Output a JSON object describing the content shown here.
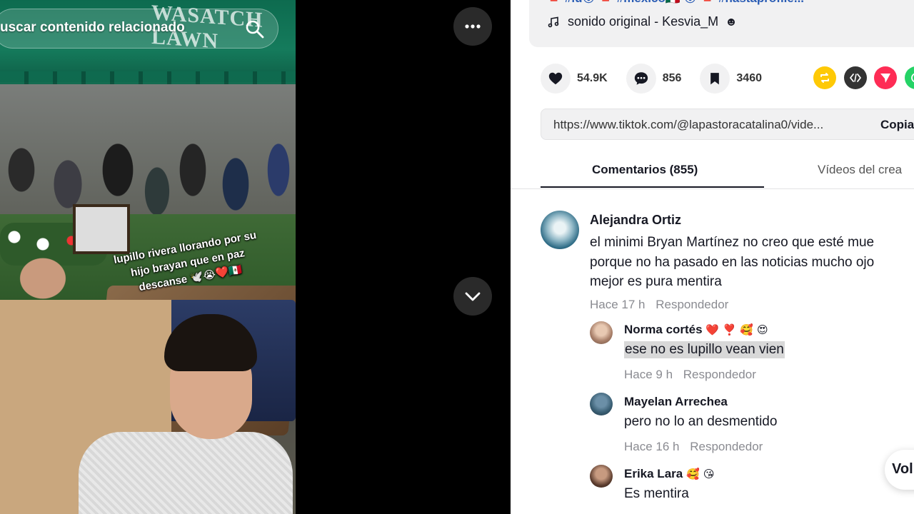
{
  "video": {
    "search_text": "uscar contenido relacionado",
    "tent_text": "WASATCH LAWN",
    "caption_line1": "lupillo rivera llorando por su",
    "caption_line2": "hijo brayan que en paz",
    "caption_line3": "descanse 🕊️😭❤️🇲🇽",
    "icons": [
      "search-icon",
      "more-icon",
      "chevron-down-icon"
    ]
  },
  "description": {
    "tags": "🔺 #lu😮 🔺 #mexico🇲🇽 😮 🔺 #hastaprofile...",
    "sound_label": "sonido original - Kesvia_M"
  },
  "actions": {
    "likes": "54.9K",
    "comments": "856",
    "saves": "3460"
  },
  "share_colors": {
    "repost": "#fec906",
    "embed": "#333333",
    "send": "#fe2c55",
    "whatsapp": "#25d366"
  },
  "link": {
    "url": "https://www.tiktok.com/@lapastoracatalina0/vide...",
    "copy_label": "Copia"
  },
  "tabs": {
    "comments_label": "Comentarios (855)",
    "videos_label": "Vídeos del crea"
  },
  "comments": [
    {
      "author": "Alejandra Ortiz",
      "text_line1": "el minimi Bryan Martínez no creo que esté mue",
      "text_line2": "porque no ha pasado en las noticias mucho ojo",
      "text_line3": "mejor es pura mentira",
      "time": "Hace 17 h",
      "reply_label": "Respondedor"
    }
  ],
  "replies": [
    {
      "author": "Norma cortés",
      "emojis": "❤️ ❣️ 🥰 😍",
      "text": "ese no es lupillo vean vien",
      "time": "Hace 9 h",
      "reply_label": "Respondedor"
    },
    {
      "author": "Mayelan Arrechea",
      "text": "pero no lo an desmentido",
      "time": "Hace 16 h",
      "reply_label": "Respondedor"
    },
    {
      "author": "Erika Lara",
      "emojis": "🥰 😘",
      "text": "Es mentira",
      "time": "",
      "reply_label": ""
    }
  ],
  "floating": {
    "vol_label": "Vol"
  },
  "colors": {
    "accent": "#fe2c55",
    "link": "#2b5db5",
    "muted": "#8a8b91"
  }
}
